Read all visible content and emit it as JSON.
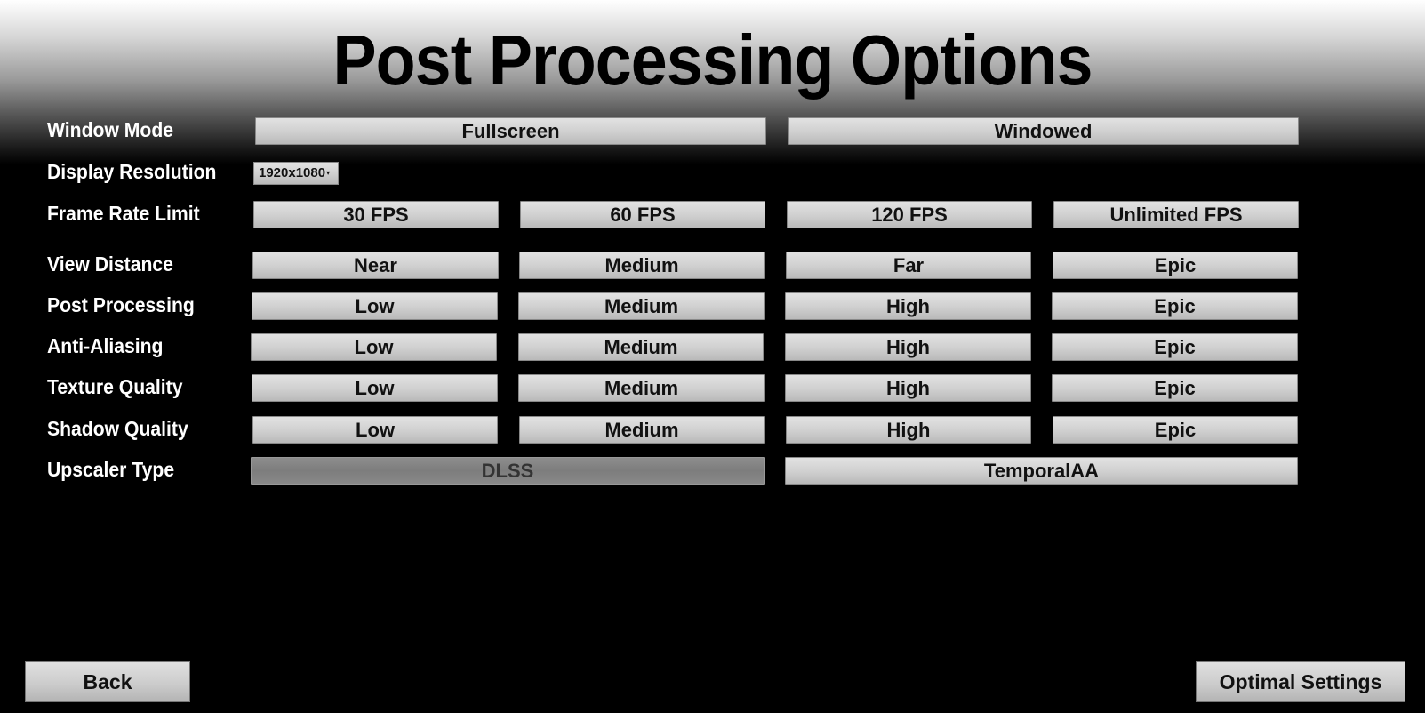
{
  "title": "Post Processing Options",
  "rows": {
    "window_mode": {
      "label": "Window Mode",
      "options": [
        "Fullscreen",
        "Windowed"
      ]
    },
    "display_resolution": {
      "label": "Display Resolution",
      "selected": "1920x1080",
      "caret": "▾"
    },
    "frame_rate_limit": {
      "label": "Frame Rate Limit",
      "options": [
        "30 FPS",
        "60 FPS",
        "120 FPS",
        "Unlimited FPS"
      ]
    },
    "view_distance": {
      "label": "View Distance",
      "options": [
        "Near",
        "Medium",
        "Far",
        "Epic"
      ]
    },
    "post_processing": {
      "label": "Post Processing",
      "options": [
        "Low",
        "Medium",
        "High",
        "Epic"
      ]
    },
    "anti_aliasing": {
      "label": "Anti-Aliasing",
      "options": [
        "Low",
        "Medium",
        "High",
        "Epic"
      ]
    },
    "texture_quality": {
      "label": "Texture Quality",
      "options": [
        "Low",
        "Medium",
        "High",
        "Epic"
      ]
    },
    "shadow_quality": {
      "label": "Shadow Quality",
      "options": [
        "Low",
        "Medium",
        "High",
        "Epic"
      ]
    },
    "upscaler_type": {
      "label": "Upscaler Type",
      "options": [
        "DLSS",
        "TemporalAA"
      ],
      "disabled": "DLSS"
    }
  },
  "footer": {
    "back_label": "Back",
    "optimal_label": "Optimal Settings"
  }
}
